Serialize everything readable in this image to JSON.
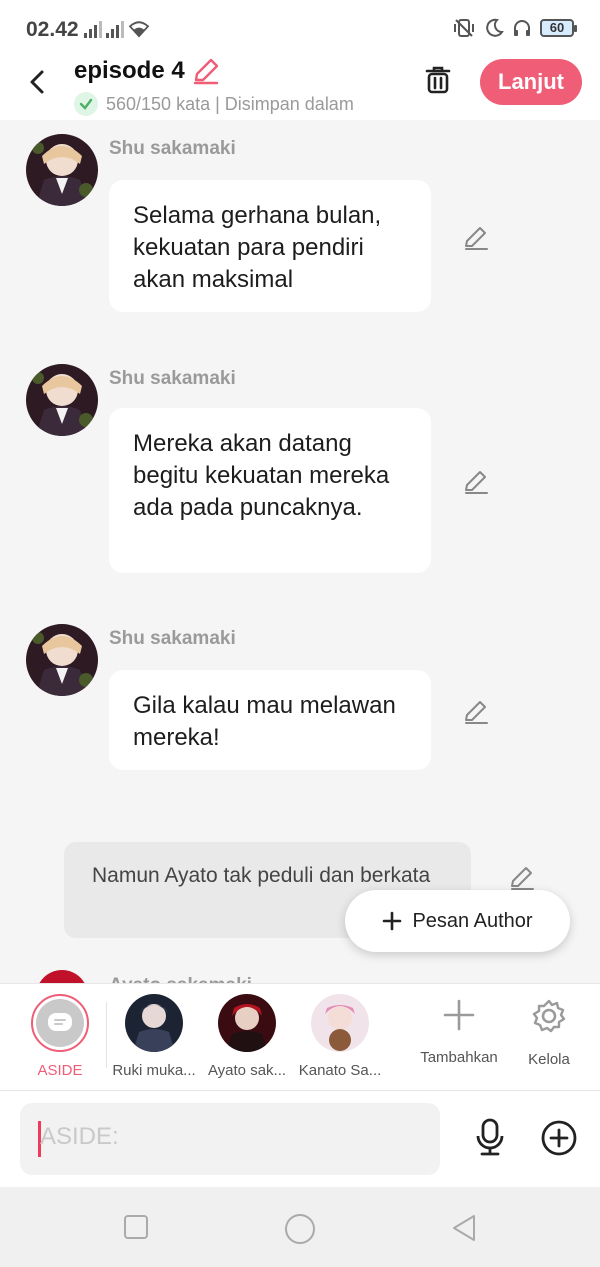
{
  "status_bar": {
    "time": "02.42",
    "battery": "60"
  },
  "header": {
    "title": "episode 4",
    "subtitle": "560/150 kata | Disimpan dalam",
    "primary_button": "Lanjut"
  },
  "messages": [
    {
      "sender": "Shu sakamaki",
      "text": "Selama gerhana bulan, kekuatan para pendiri akan maksimal"
    },
    {
      "sender": "Shu sakamaki",
      "text": "Mereka akan datang begitu kekuatan mereka ada pada puncaknya."
    },
    {
      "sender": "Shu sakamaki",
      "text": "Gila kalau mau melawan mereka!"
    }
  ],
  "narration": {
    "text": "Namun Ayato tak peduli dan berkata"
  },
  "next_sender_partial": "Ayato sakamaki",
  "floating_button": {
    "label": "Pesan Author"
  },
  "characters": [
    {
      "label": "ASIDE"
    },
    {
      "label": "Ruki muka..."
    },
    {
      "label": "Ayato sak..."
    },
    {
      "label": "Kanato Sa..."
    }
  ],
  "tools": {
    "add_label": "Tambahkan",
    "manage_label": "Kelola"
  },
  "input": {
    "placeholder": "ASIDE:"
  },
  "colors": {
    "accent": "#ef5d77",
    "background": "#f5f5f5"
  }
}
